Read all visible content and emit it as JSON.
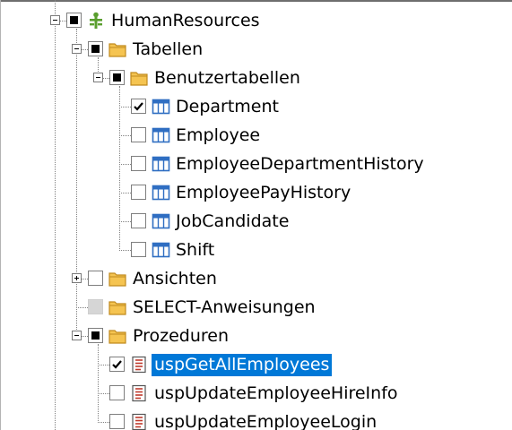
{
  "tree": {
    "nodes": [
      {
        "id": "humanresources",
        "label": "HumanResources",
        "level": 0,
        "icon": "schema-icon",
        "expander": "minus",
        "checkbox": "partial",
        "selected": false,
        "icon_color": "#5a9e2e"
      },
      {
        "id": "tabellen",
        "label": "Tabellen",
        "level": 1,
        "icon": "folder-icon",
        "expander": "minus",
        "checkbox": "partial",
        "selected": false
      },
      {
        "id": "benutzertabellen",
        "label": "Benutzertabellen",
        "level": 2,
        "icon": "folder-icon",
        "expander": "minus",
        "checkbox": "partial",
        "selected": false
      },
      {
        "id": "department",
        "label": "Department",
        "level": 3,
        "icon": "table-icon",
        "expander": "none",
        "checkbox": "checked",
        "selected": false
      },
      {
        "id": "employee",
        "label": "Employee",
        "level": 3,
        "icon": "table-icon",
        "expander": "none",
        "checkbox": "unchecked",
        "selected": false
      },
      {
        "id": "employeedepartmenthistory",
        "label": "EmployeeDepartmentHistory",
        "level": 3,
        "icon": "table-icon",
        "expander": "none",
        "checkbox": "unchecked",
        "selected": false
      },
      {
        "id": "employeepayhistory",
        "label": "EmployeePayHistory",
        "level": 3,
        "icon": "table-icon",
        "expander": "none",
        "checkbox": "unchecked",
        "selected": false
      },
      {
        "id": "jobcandidate",
        "label": "JobCandidate",
        "level": 3,
        "icon": "table-icon",
        "expander": "none",
        "checkbox": "unchecked",
        "selected": false
      },
      {
        "id": "shift",
        "label": "Shift",
        "level": 3,
        "icon": "table-icon",
        "expander": "none",
        "checkbox": "unchecked",
        "selected": false
      },
      {
        "id": "ansichten",
        "label": "Ansichten",
        "level": 1,
        "icon": "folder-icon",
        "expander": "plus",
        "checkbox": "unchecked",
        "selected": false
      },
      {
        "id": "select-anweisungen",
        "label": "SELECT-Anweisungen",
        "level": 1,
        "icon": "folder-icon",
        "expander": "none",
        "checkbox": "disabled",
        "selected": false
      },
      {
        "id": "prozeduren",
        "label": "Prozeduren",
        "level": 1,
        "icon": "folder-icon",
        "expander": "minus",
        "checkbox": "partial",
        "selected": false
      },
      {
        "id": "uspgetallemployees",
        "label": "uspGetAllEmployees",
        "level": 2,
        "icon": "procedure-icon",
        "expander": "none",
        "checkbox": "checked",
        "selected": true
      },
      {
        "id": "uspupdateemployeehireinfo",
        "label": "uspUpdateEmployeeHireInfo",
        "level": 2,
        "icon": "procedure-icon",
        "expander": "none",
        "checkbox": "unchecked",
        "selected": false
      },
      {
        "id": "uspupdateemployeelogin",
        "label": "uspUpdateEmployeeLogin",
        "level": 2,
        "icon": "procedure-icon",
        "expander": "none",
        "checkbox": "unchecked",
        "selected": false
      }
    ],
    "colors": {
      "selection_bg": "#0078d7",
      "selection_text": "#ffffff",
      "folder_fill": "#f5c451",
      "folder_stroke": "#c08a1e",
      "table_blue": "#2f6ec2",
      "procedure_red": "#c0392b",
      "schema_green": "#5a9e2e"
    }
  }
}
